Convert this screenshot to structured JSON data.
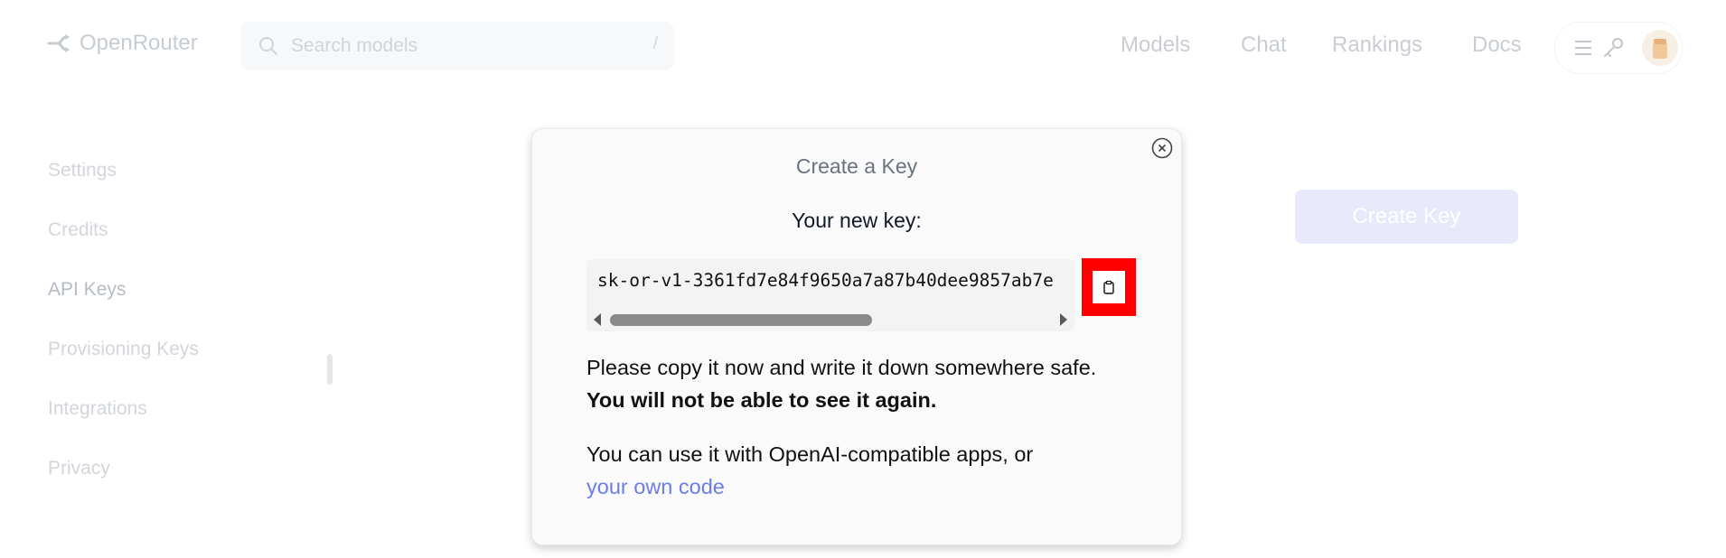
{
  "header": {
    "brand": "OpenRouter",
    "search": {
      "placeholder": "Search models",
      "shortcut": "/"
    },
    "nav": [
      "Models",
      "Chat",
      "Rankings",
      "Docs"
    ]
  },
  "sidebar": {
    "items": [
      {
        "label": "Settings"
      },
      {
        "label": "Credits"
      },
      {
        "label": "API Keys",
        "active": true
      },
      {
        "label": "Provisioning Keys"
      },
      {
        "label": "Integrations"
      },
      {
        "label": "Privacy"
      }
    ]
  },
  "background": {
    "create_key_label": "Create Key"
  },
  "modal": {
    "title": "Create a Key",
    "subtitle": "Your new key:",
    "key_value": "sk-or-v1-3361fd7e84f9650a7a87b40dee9857ab7e",
    "copy_icon": "clipboard-icon",
    "warning_text": "Please copy it now and write it down somewhere safe.",
    "warning_bold": "You will not be able to see it again.",
    "usage_text": "You can use it with OpenAI-compatible apps, or",
    "usage_link": "your own code"
  },
  "colors": {
    "accent": "#6b7ee8",
    "highlight": "#ff0000",
    "button_bg": "#e8e9fb"
  }
}
